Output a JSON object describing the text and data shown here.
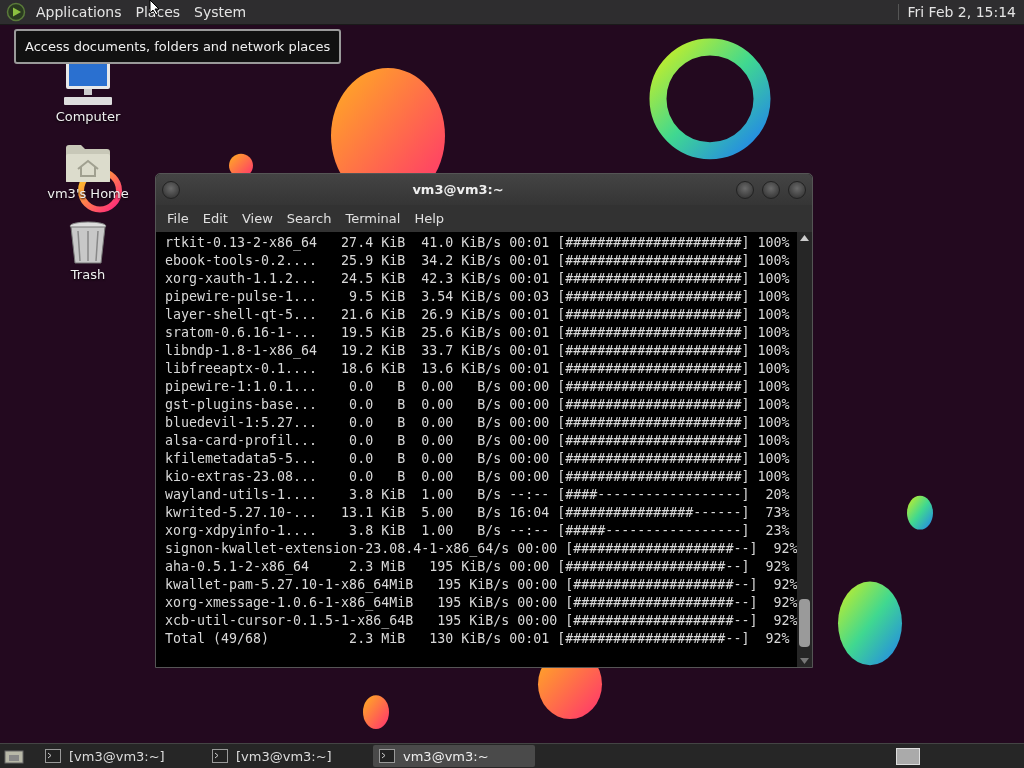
{
  "top_panel": {
    "menus": [
      "Applications",
      "Places",
      "System"
    ],
    "clock": "Fri Feb 2, 15:14"
  },
  "tooltip": "Access documents, folders and network places",
  "desktop_icons": [
    {
      "label": "Computer",
      "kind": "computer"
    },
    {
      "label": "vm3's Home",
      "kind": "home"
    },
    {
      "label": "Trash",
      "kind": "trash"
    }
  ],
  "terminal": {
    "title": "vm3@vm3:~",
    "menu": [
      "File",
      "Edit",
      "View",
      "Search",
      "Terminal",
      "Help"
    ],
    "lines": [
      "rtkit-0.13-2-x86_64   27.4 KiB  41.0 KiB/s 00:01 [######################] 100%",
      "ebook-tools-0.2....   25.9 KiB  34.2 KiB/s 00:01 [######################] 100%",
      "xorg-xauth-1.1.2...   24.5 KiB  42.3 KiB/s 00:01 [######################] 100%",
      "pipewire-pulse-1...    9.5 KiB  3.54 KiB/s 00:03 [######################] 100%",
      "layer-shell-qt-5...   21.6 KiB  26.9 KiB/s 00:01 [######################] 100%",
      "sratom-0.6.16-1-...   19.5 KiB  25.6 KiB/s 00:01 [######################] 100%",
      "libndp-1.8-1-x86_64   19.2 KiB  33.7 KiB/s 00:01 [######################] 100%",
      "libfreeaptx-0.1....   18.6 KiB  13.6 KiB/s 00:01 [######################] 100%",
      "pipewire-1:1.0.1...    0.0   B  0.00   B/s 00:00 [######################] 100%",
      "gst-plugins-base...    0.0   B  0.00   B/s 00:00 [######################] 100%",
      "bluedevil-1:5.27...    0.0   B  0.00   B/s 00:00 [######################] 100%",
      "alsa-card-profil...    0.0   B  0.00   B/s 00:00 [######################] 100%",
      "kfilemetadata5-5...    0.0   B  0.00   B/s 00:00 [######################] 100%",
      "kio-extras-23.08...    0.0   B  0.00   B/s 00:00 [######################] 100%",
      "wayland-utils-1....    3.8 KiB  1.00   B/s --:-- [####------------------]  20%",
      "kwrited-5.27.10-...   13.1 KiB  5.00   B/s 16:04 [################------]  73%",
      "xorg-xdpyinfo-1....    3.8 KiB  1.00   B/s --:-- [#####-----------------]  23%",
      "signon-kwallet-extension-23.08.4-1-x86_64/s 00:00 [####################--]  92%",
      "aha-0.5.1-2-x86_64     2.3 MiB   195 KiB/s 00:00 [####################--]  92%",
      "kwallet-pam-5.27.10-1-x86_64MiB   195 KiB/s 00:00 [####################--]  92%",
      "xorg-xmessage-1.0.6-1-x86_64MiB   195 KiB/s 00:00 [####################--]  92%",
      "xcb-util-cursor-0.1.5-1-x86_64B   195 KiB/s 00:00 [####################--]  92%",
      "Total (49/68)          2.3 MiB   130 KiB/s 00:01 [####################--]  92%"
    ]
  },
  "taskbar": {
    "tasks": [
      {
        "label": "[vm3@vm3:~]",
        "selected": false
      },
      {
        "label": "[vm3@vm3:~]",
        "selected": false
      },
      {
        "label": "vm3@vm3:~",
        "selected": true
      }
    ]
  }
}
